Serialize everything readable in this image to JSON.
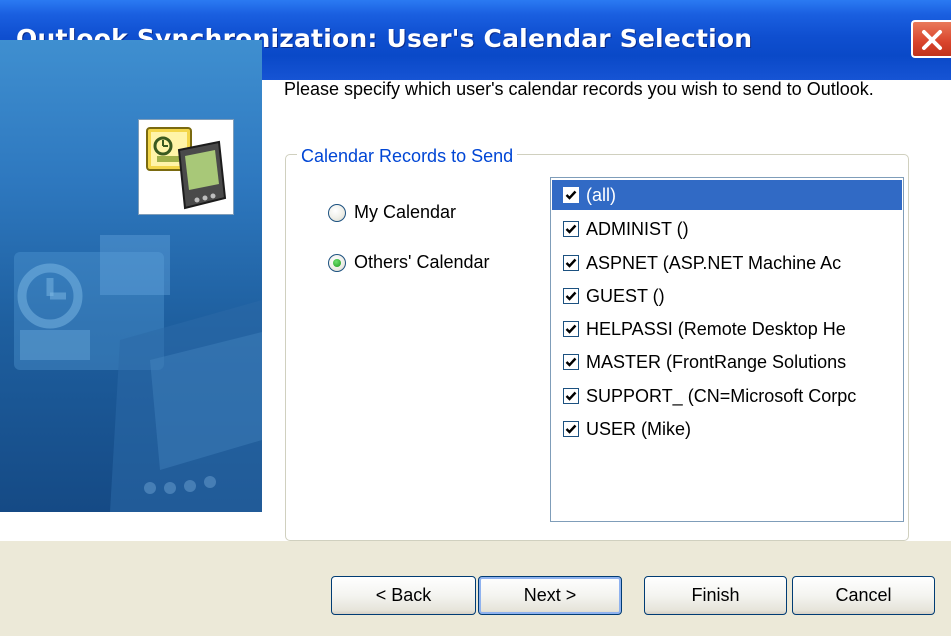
{
  "window": {
    "title": "Outlook Synchronization: User's Calendar Selection"
  },
  "prompt": "Please specify which user's calendar records you wish to send to Outlook.",
  "group": {
    "legend": "Calendar Records to Send",
    "options": [
      {
        "label": "My Calendar",
        "checked": false
      },
      {
        "label": "Others' Calendar",
        "checked": true
      }
    ]
  },
  "users": [
    {
      "label": "(all)",
      "checked": true,
      "selected": true
    },
    {
      "label": "ADMINIST ()",
      "checked": true,
      "selected": false
    },
    {
      "label": "ASPNET (ASP.NET Machine Ac",
      "checked": true,
      "selected": false
    },
    {
      "label": "GUEST ()",
      "checked": true,
      "selected": false
    },
    {
      "label": "HELPASSI (Remote Desktop He",
      "checked": true,
      "selected": false
    },
    {
      "label": "MASTER (FrontRange Solutions",
      "checked": true,
      "selected": false
    },
    {
      "label": "SUPPORT_ (CN=Microsoft Corpc",
      "checked": true,
      "selected": false
    },
    {
      "label": "USER (Mike)",
      "checked": true,
      "selected": false
    }
  ],
  "buttons": {
    "back": "< Back",
    "next": "Next >",
    "finish": "Finish",
    "cancel": "Cancel"
  },
  "icons": {
    "close": "close-icon",
    "logo": "outlook-handheld-icon",
    "checkbox": "checkmark-icon"
  },
  "colors": {
    "titlebar": "#0a49c8",
    "selection": "#316ac5",
    "legend": "#0046d5",
    "dialog_face": "#ece9d8"
  }
}
